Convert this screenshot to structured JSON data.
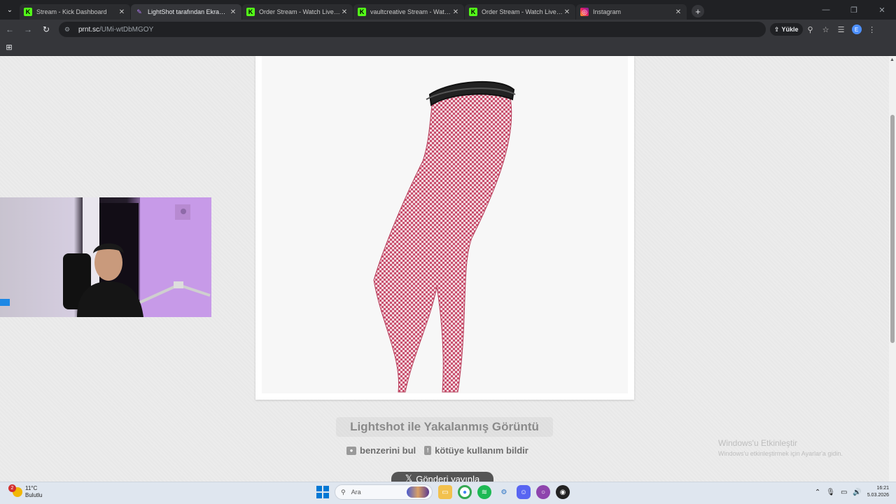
{
  "browser": {
    "tabs": [
      {
        "title": "Stream - Kick Dashboard",
        "favicon": "kick-icon",
        "active": false
      },
      {
        "title": "LightShot tarafından Ekran Görüntüsü",
        "favicon": "lightshot-icon",
        "active": true
      },
      {
        "title": "Order Stream - Watch Live on Kick",
        "favicon": "kick-icon",
        "active": false
      },
      {
        "title": "vaultcreative Stream - Watch Live on Kick",
        "favicon": "kick-icon",
        "active": false
      },
      {
        "title": "Order Stream - Watch Live on Kick",
        "favicon": "kick-icon",
        "active": false
      },
      {
        "title": "Instagram",
        "favicon": "instagram-icon",
        "active": false
      }
    ],
    "address": {
      "host": "prnt.sc",
      "path": "/UMi-wtDbMGOY"
    },
    "upload_label": "Yükle",
    "profile_initial": "E"
  },
  "page": {
    "caption": "Lightshot ile Yakalanmış Görüntü",
    "actions": [
      {
        "label": "benzerini bul",
        "icon": "camera-icon"
      },
      {
        "label": "kötüye kullanım bildir",
        "icon": "report-icon"
      }
    ],
    "tweet_label": "Gönderi yayınla",
    "watermark": {
      "title": "Windows'u Etkinleştir",
      "subtitle": "Windows'u etkinleştirmek için Ayarlar'a gidin."
    }
  },
  "taskbar": {
    "weather_temp": "11°C",
    "weather_desc": "Bulutlu",
    "weather_badge": "2",
    "search_placeholder": "Ara",
    "time": "16:21",
    "date": "5.03.2026"
  },
  "colors": {
    "kick_green": "#53fc18",
    "keffiyeh_red": "#c8506e",
    "taskbar_bg": "#dfe6ef"
  }
}
